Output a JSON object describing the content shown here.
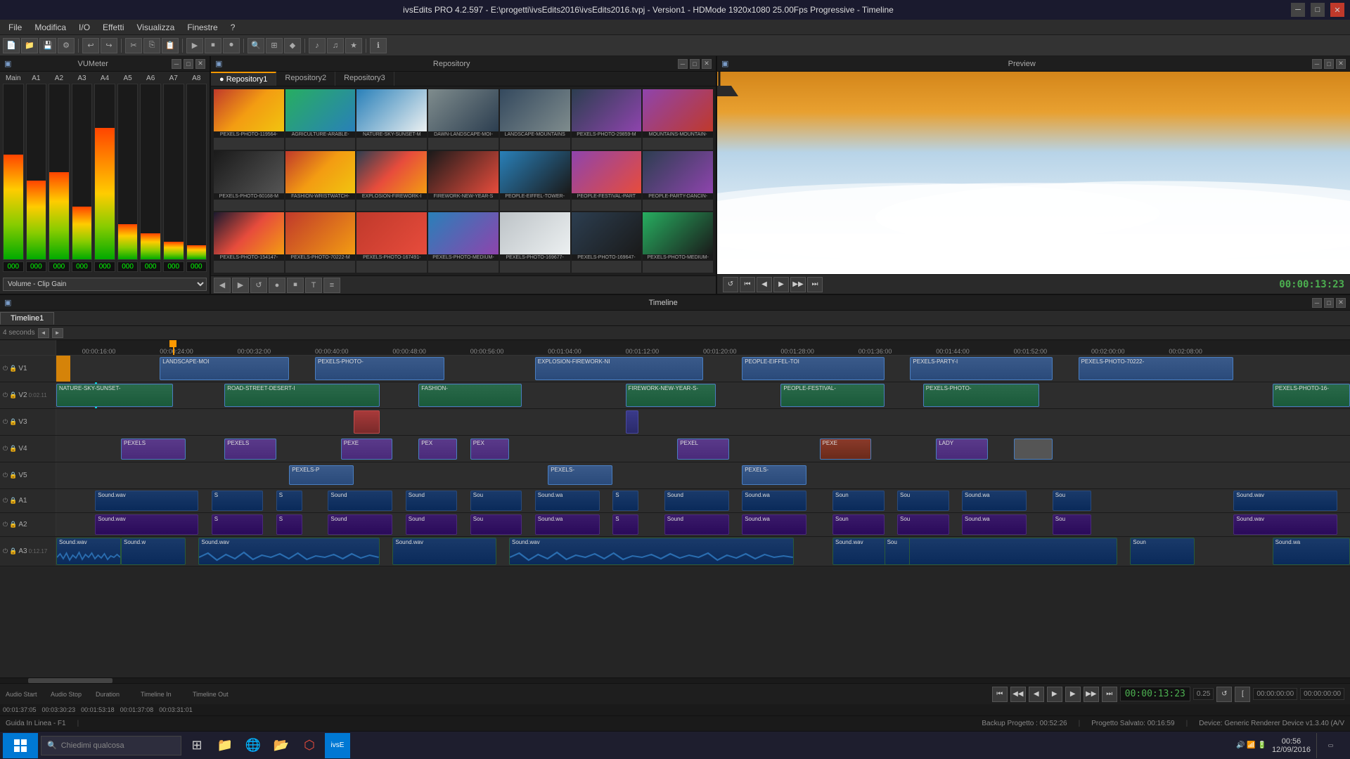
{
  "window": {
    "title": "ivsEdits PRO 4.2.597 - E:\\progetti\\ivsEdits2016\\ivsEdits2016.tvpj - Version1 - HDMode 1920x1080 25.00Fps Progressive - Timeline"
  },
  "menu": {
    "items": [
      "File",
      "Modifica",
      "I/O",
      "Effetti",
      "Visualizza",
      "Finestre",
      "?"
    ]
  },
  "panels": {
    "vumeter": {
      "title": "VUMeter",
      "channels": [
        "Main",
        "A1",
        "A2",
        "A3",
        "A4",
        "A5",
        "A6",
        "A7",
        "A8"
      ],
      "dropdown_label": "Volume - Clip Gain"
    },
    "repository": {
      "title": "Repository",
      "tabs": [
        "Repository1",
        "Repository2",
        "Repository3"
      ],
      "thumbnails": [
        {
          "label": "PEXELS-PHOTO-119564-",
          "color": "thumb-sunset"
        },
        {
          "label": "AGRICULTURE-ARABLE-",
          "color": "thumb-field"
        },
        {
          "label": "NATURE-SKY-SUNSET-M",
          "color": "thumb-sky"
        },
        {
          "label": "DAWN-LANDSCAPE-MOI-",
          "color": "thumb-mountain"
        },
        {
          "label": "LANDSCAPE-MOUNTAINS",
          "color": "thumb-landscape"
        },
        {
          "label": "PEXELS-PHOTO-29859-M",
          "color": "thumb-night"
        },
        {
          "label": "MOUNTAINS-MOUNTAIN-",
          "color": "thumb-purple"
        },
        {
          "label": "PEXELS-PHOTO-60168-M",
          "color": "thumb-fashion"
        },
        {
          "label": "FASHION-WRISTWATCH-",
          "color": "thumb-sunset"
        },
        {
          "label": "EXPLOSION-FIREWORK-I",
          "color": "thumb-firework"
        },
        {
          "label": "FIREWORK-NEW-YEAR-S",
          "color": "thumb-firework2"
        },
        {
          "label": "PEOPLE-EIFFEL-TOWER-",
          "color": "thumb-people"
        },
        {
          "label": "PEOPLE-FESTIVAL-PART",
          "color": "thumb-festival"
        },
        {
          "label": "PEOPLE-PARTY-DANCIN-",
          "color": "thumb-party"
        },
        {
          "label": "PEXELS-PHOTO-154147-",
          "color": "thumb-concert"
        },
        {
          "label": "PEXELS-PHOTO-70222-M",
          "color": "thumb-concert2"
        },
        {
          "label": "PEXELS-PHOTO-167491-",
          "color": "thumb-speed"
        },
        {
          "label": "PEXELS-PHOTO-MEDIUM-",
          "color": "thumb-city"
        },
        {
          "label": "PEXELS-PHOTO-169677-",
          "color": "thumb-white"
        },
        {
          "label": "PEXELS-PHOTO-169647-",
          "color": "thumb-dark"
        },
        {
          "label": "PEXELS-PHOTO-MEDIUM-",
          "color": "thumb-green2"
        }
      ]
    },
    "preview": {
      "title": "Preview",
      "timecode": "00:00:13:23"
    }
  },
  "timeline": {
    "title": "Timeline",
    "tab": "Timeline1",
    "scale_label": "4 seconds",
    "scale_arrow_left": "◄",
    "scale_arrow_right": "►",
    "timecode": "00:00:13:23",
    "speed": "0.25",
    "audio_start": "00:01:37:05",
    "audio_stop": "00:03:30:23",
    "duration": "00:01:53:18",
    "timeline_in": "00:01:37:08",
    "timeline_out": "00:03:31:01",
    "tracks": [
      {
        "id": "V1",
        "type": "video",
        "label": "V1"
      },
      {
        "id": "V2",
        "type": "video",
        "label": "V2"
      },
      {
        "id": "V3",
        "type": "video",
        "label": "V3"
      },
      {
        "id": "V4",
        "type": "video",
        "label": "V4"
      },
      {
        "id": "V5",
        "type": "video",
        "label": "V5"
      },
      {
        "id": "A1",
        "type": "audio",
        "label": "A1"
      },
      {
        "id": "A2",
        "type": "audio",
        "label": "A2"
      },
      {
        "id": "A3",
        "type": "audio-big",
        "label": "A3"
      }
    ],
    "ruler_marks": [
      "00:00:16:00",
      "00:00:24:00",
      "00:00:32:00",
      "00:00:40:00",
      "00:00:48:00",
      "00:00:56:00",
      "00:01:04:00",
      "00:01:12:00",
      "00:01:20:00",
      "00:01:28:00",
      "00:01:36:00",
      "00:01:44:00",
      "00:01:52:00",
      "00:02:00:00",
      "00:02:08:00"
    ]
  },
  "status_bar": {
    "guide": "Guida In Linea - F1",
    "backup": "Backup Progetto : 00:52:26",
    "saved": "Progetto Salvato: 00:16:59",
    "device": "Device: Generic Renderer Device v1.3.40 (A/V"
  },
  "taskbar": {
    "search_placeholder": "Chiedimi qualcosa",
    "time": "00:56",
    "date": "12/09/2016"
  }
}
